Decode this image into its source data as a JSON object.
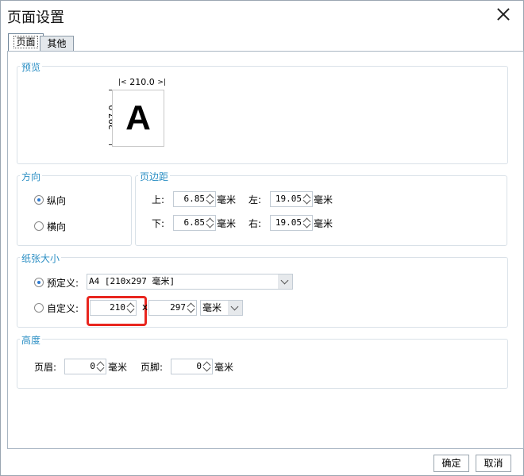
{
  "dialog": {
    "title": "页面设置"
  },
  "tabs": [
    {
      "label": "页面"
    },
    {
      "label": "其他"
    }
  ],
  "preview": {
    "legend": "预览",
    "width": "210.0",
    "height": "297.0",
    "letter": "A"
  },
  "orientation": {
    "legend": "方向",
    "portrait": "纵向",
    "landscape": "横向",
    "selected": "纵向"
  },
  "margins": {
    "legend": "页边距",
    "top_label": "上:",
    "top_value": "6.85",
    "left_label": "左:",
    "left_value": "19.05",
    "bottom_label": "下:",
    "bottom_value": "6.85",
    "right_label": "右:",
    "right_value": "19.05",
    "unit": "毫米"
  },
  "paper": {
    "legend": "纸张大小",
    "predefined_label": "预定义:",
    "predefined_value": "A4 [210x297 毫米]",
    "custom_label": "自定义:",
    "custom_width": "210",
    "separator": "x",
    "custom_height": "297",
    "custom_unit": "毫米",
    "selected": "预定义"
  },
  "height": {
    "legend": "高度",
    "header_label": "页眉:",
    "header_value": "0",
    "footer_label": "页脚:",
    "footer_value": "0",
    "unit": "毫米"
  },
  "buttons": {
    "ok": "确定",
    "cancel": "取消"
  },
  "colors": {
    "accent": "#2c8fc4",
    "highlight": "#e8261f"
  }
}
